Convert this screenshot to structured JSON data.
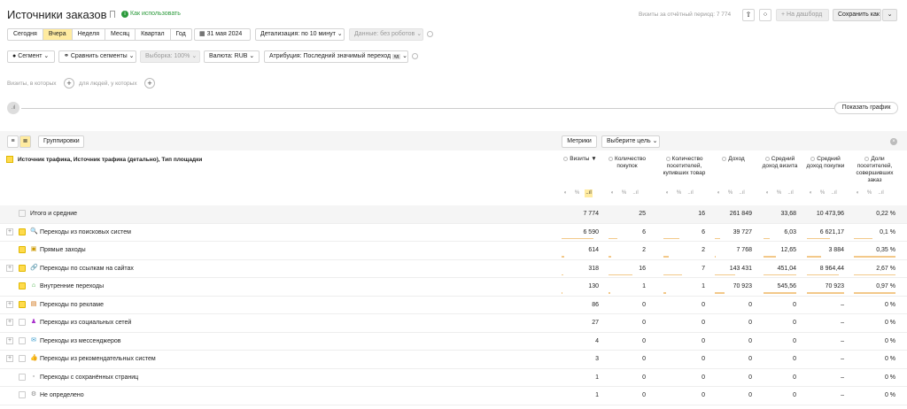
{
  "header": {
    "title": "Источники заказов",
    "how_to_use": "Как использовать",
    "visits_period": "Визиты за отчётный период: 7 774",
    "to_dashboard": "На дашборд",
    "save_as": "Сохранить как"
  },
  "periods": [
    "Сегодня",
    "Вчера",
    "Неделя",
    "Месяц",
    "Квартал",
    "Год"
  ],
  "toolbar": {
    "date": "31 мая 2024",
    "detail": "Детализация: по 10 минут",
    "data": "Данные: без роботов",
    "segment": "Сегмент",
    "compare": "Сравнить сегменты",
    "sample": "Выборка: 100%",
    "currency": "Валюта: RUB",
    "attribution": "Атрибуция: Последний значимый переход",
    "attribution_badge": "кд"
  },
  "filters": {
    "visits_which": "Визиты, в которых",
    "for_people": "для людей, у которых"
  },
  "chart": {
    "show_chart": "Показать график"
  },
  "table_controls": {
    "groupings": "Группировки",
    "metrics": "Метрики",
    "choose_goal": "Выберите цель"
  },
  "table": {
    "dimension_header": "Источник трафика, Источник трафика (детально), Тип площадки",
    "columns": [
      "Визиты",
      "Количество покупок",
      "Количество посетителей, купивших товар",
      "Доход",
      "Средний доход визита",
      "Средний доход покупки",
      "Доли посетителей, совершивших заказ"
    ],
    "sort_marker": "▼",
    "icon_hint": [
      "◐",
      "%",
      "..ıl"
    ],
    "rows": [
      {
        "name": "Итого и средние",
        "expand": "",
        "icon": "",
        "checked": false,
        "values": [
          "7 774",
          "25",
          "16",
          "261 849",
          "33,68",
          "10 473,96",
          "0,22 %"
        ],
        "bars": [
          1,
          1,
          1,
          1,
          1,
          1,
          1
        ]
      },
      {
        "name": "Переходы из поисковых систем",
        "expand": "+",
        "icon": "search",
        "checked": true,
        "values": [
          "6 590",
          "6",
          "6",
          "39 727",
          "6,03",
          "6 621,17",
          "0,1 %"
        ],
        "bars": [
          0.85,
          0.24,
          0.38,
          0.15,
          0.18,
          0.63,
          0.45
        ]
      },
      {
        "name": "Прямые заходы",
        "expand": "",
        "icon": "direct",
        "checked": true,
        "values": [
          "614",
          "2",
          "2",
          "7 768",
          "12,65",
          "3 884",
          "0,35 %"
        ],
        "bars": [
          0.08,
          0.08,
          0.13,
          0.03,
          0.38,
          0.37,
          1
        ]
      },
      {
        "name": "Переходы по ссылкам на сайтах",
        "expand": "+",
        "icon": "link",
        "checked": true,
        "values": [
          "318",
          "16",
          "7",
          "143 431",
          "451,04",
          "8 964,44",
          "2,67 %"
        ],
        "bars": [
          0.04,
          0.64,
          0.44,
          0.55,
          1,
          0.86,
          1
        ]
      },
      {
        "name": "Внутренние переходы",
        "expand": "",
        "icon": "internal",
        "checked": true,
        "values": [
          "130",
          "1",
          "1",
          "70 923",
          "545,56",
          "70 923",
          "0,97 %"
        ],
        "bars": [
          0.02,
          0.04,
          0.06,
          0.27,
          1,
          1,
          1
        ]
      },
      {
        "name": "Переходы по рекламе",
        "expand": "+",
        "icon": "ads",
        "checked": true,
        "values": [
          "86",
          "0",
          "0",
          "0",
          "0",
          "–",
          "0 %"
        ],
        "bars": [
          0.01,
          0,
          0,
          0,
          0,
          0,
          0
        ]
      },
      {
        "name": "Переходы из социальных сетей",
        "expand": "+",
        "icon": "social",
        "checked": false,
        "values": [
          "27",
          "0",
          "0",
          "0",
          "0",
          "–",
          "0 %"
        ],
        "bars": [
          0,
          0,
          0,
          0,
          0,
          0,
          0
        ]
      },
      {
        "name": "Переходы из мессенджеров",
        "expand": "+",
        "icon": "messenger",
        "checked": false,
        "values": [
          "4",
          "0",
          "0",
          "0",
          "0",
          "–",
          "0 %"
        ],
        "bars": [
          0,
          0,
          0,
          0,
          0,
          0,
          0
        ]
      },
      {
        "name": "Переходы из рекомендательных систем",
        "expand": "+",
        "icon": "recommend",
        "checked": false,
        "values": [
          "3",
          "0",
          "0",
          "0",
          "0",
          "–",
          "0 %"
        ],
        "bars": [
          0,
          0,
          0,
          0,
          0,
          0,
          0
        ]
      },
      {
        "name": "Переходы с сохранённых страниц",
        "expand": "",
        "icon": "saved",
        "checked": false,
        "values": [
          "1",
          "0",
          "0",
          "0",
          "0",
          "–",
          "0 %"
        ],
        "bars": [
          0,
          0,
          0,
          0,
          0,
          0,
          0
        ]
      },
      {
        "name": "Не определено",
        "expand": "",
        "icon": "undefined",
        "checked": false,
        "values": [
          "1",
          "0",
          "0",
          "0",
          "0",
          "–",
          "0 %"
        ],
        "bars": [
          0,
          0,
          0,
          0,
          0,
          0,
          0
        ]
      }
    ]
  },
  "colors": {
    "accent_yellow": "#ffeba0",
    "checkbox_yellow": "#ffdb4d",
    "bar_orange": "#f3c98a",
    "how_to_use_green": "#2c9a3c"
  }
}
